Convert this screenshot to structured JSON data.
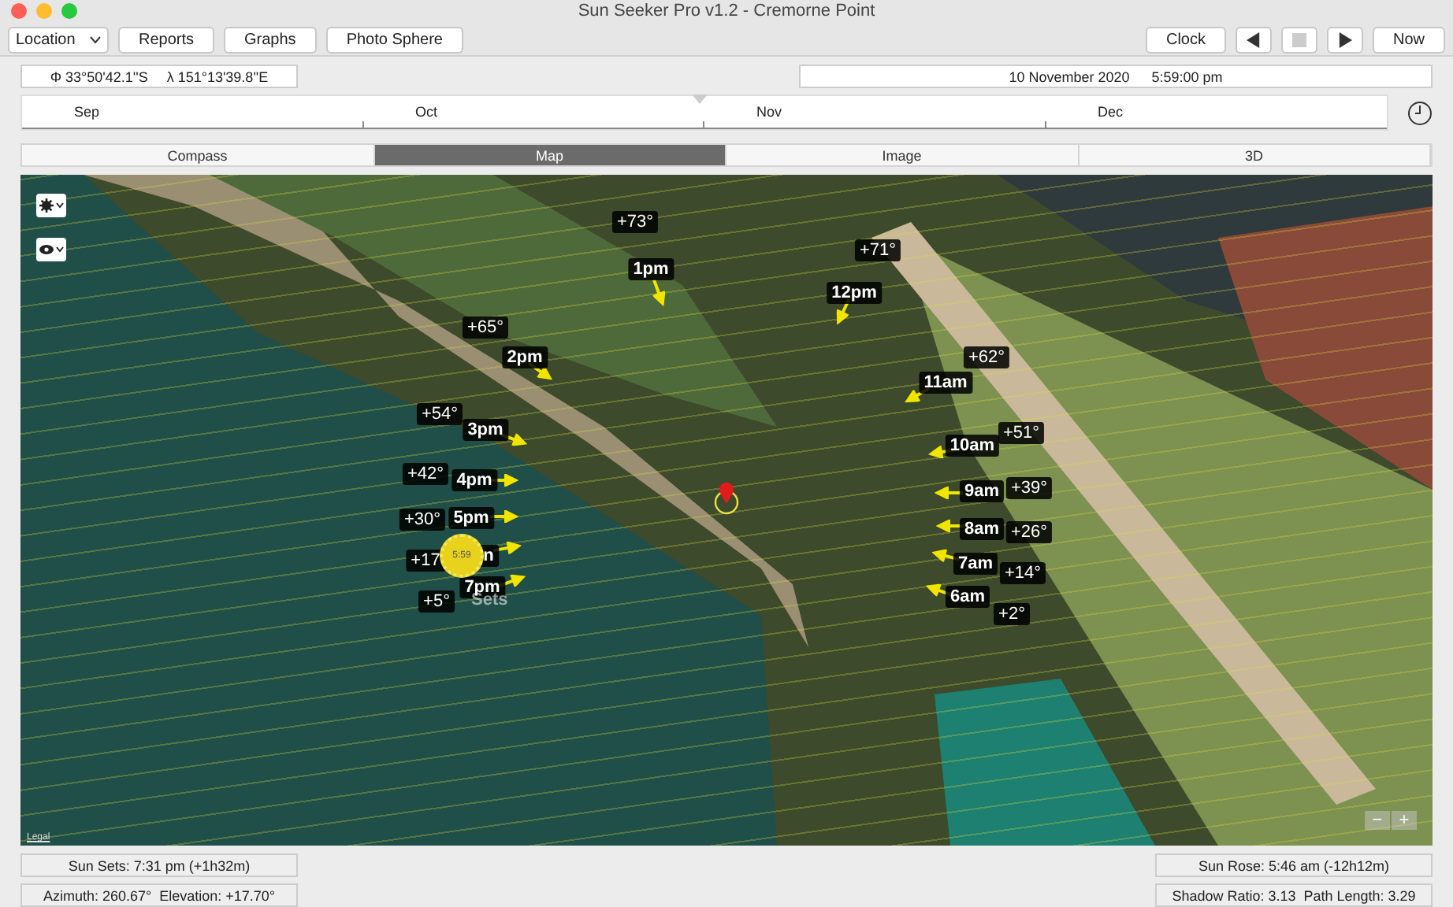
{
  "window": {
    "title": "Sun Seeker Pro v1.2 - Cremorne Point"
  },
  "toolbar": {
    "location_select": "Location",
    "buttons": [
      "Reports",
      "Graphs",
      "Photo Sphere"
    ],
    "clock_button": "Clock",
    "now_button": "Now"
  },
  "coordinates": {
    "latitude": "Φ 33°50'42.1''S",
    "longitude": "λ 151°13'39.8''E"
  },
  "datetime": {
    "date": "10 November 2020",
    "time": "5:59:00 pm"
  },
  "timeline": {
    "months": [
      "Sep",
      "Oct",
      "Nov",
      "Dec"
    ]
  },
  "tabs": [
    {
      "label": "Compass",
      "selected": false
    },
    {
      "label": "Map",
      "selected": true
    },
    {
      "label": "Image",
      "selected": false
    },
    {
      "label": "3D",
      "selected": false
    }
  ],
  "map": {
    "sun_marker": "5:59",
    "sets_label": "Sets",
    "legal": "Legal",
    "zoom_out": "−",
    "zoom_in": "+",
    "hours": [
      {
        "time": "1pm",
        "elevation": "+73°"
      },
      {
        "time": "2pm",
        "elevation": "+65°"
      },
      {
        "time": "3pm",
        "elevation": "+54°"
      },
      {
        "time": "4pm",
        "elevation": "+42°"
      },
      {
        "time": "5pm",
        "elevation": "+30°"
      },
      {
        "time": "n",
        "elevation": "+17"
      },
      {
        "time": "7pm",
        "elevation": "+5°"
      },
      {
        "time": "12pm",
        "elevation": "+71°"
      },
      {
        "time": "11am",
        "elevation": "+62°"
      },
      {
        "time": "10am",
        "elevation": "+51°"
      },
      {
        "time": "9am",
        "elevation": "+39°"
      },
      {
        "time": "8am",
        "elevation": "+26°"
      },
      {
        "time": "7am",
        "elevation": "+14°"
      },
      {
        "time": "6am",
        "elevation": "+2°"
      }
    ]
  },
  "status": {
    "left": [
      "Sun Sets: 7:31 pm (+1h32m)",
      "Azimuth: 260.67°  Elevation: +17.70°"
    ],
    "right": [
      "Sun Rose: 5:46 am (-12h12m)",
      "Shadow Ratio: 3.13  Path Length: 3.29"
    ]
  }
}
